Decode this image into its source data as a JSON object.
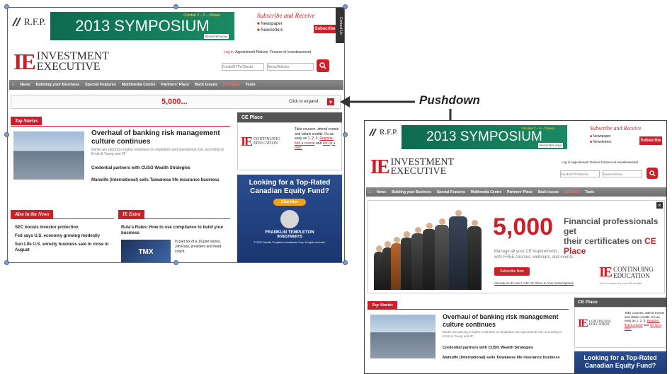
{
  "left": {
    "rfp_logo": "R.F.P.",
    "symposium": {
      "dates": "October 2 – 5 – Ottawa",
      "title": "2013 SYMPOSIUM",
      "register": "REGISTER NOW"
    },
    "subscribe": {
      "title": "Subscribe and Receive",
      "items": [
        "Newspaper",
        "Newsletters"
      ],
      "button": "Subscribe"
    },
    "contact_tab": "Contact Us",
    "ie": {
      "letters": "IE",
      "line1": "INVESTMENT",
      "line2": "EXECUTIVE"
    },
    "toplinks": [
      "Log in",
      "Appointment Notices",
      "Finance et Investissement"
    ],
    "search": {
      "placeholder1": "Funds/ETFs/Stocks",
      "placeholder2": "News/Articles"
    },
    "nav": [
      "⌂",
      "News",
      "Building your Business",
      "Special Features",
      "Multimedia Centre",
      "Partners' Place",
      "Back Issues",
      "CE Place",
      "Tools"
    ],
    "pushdown": {
      "number": "5,000...",
      "expand": "Click to expand",
      "plus": "+"
    },
    "top_stories": "Top Stories",
    "headline": "Overhaul of banking risk management culture continues",
    "headline_sub": "Banks are placing a higher emphasis on regulation and operational risk, according to Ernst & Young and IIF",
    "story2": "Credential partners with CUSO Wealth Strategies",
    "story3": "Manulife (International) sells Taiwanese life insurance business",
    "ce_place": "CE Place",
    "ce_logo": {
      "line1": "CONTINUING",
      "line2": "EDUCATION"
    },
    "ce_text": "Take courses, attend events and obtain credits. It's as easy as 1, 2, 3.",
    "ce_register": "Register,",
    "ce_find": "find a course",
    "ce_and": "and",
    "ce_setup": "set up a plan.",
    "ad": {
      "title": "Looking for a Top-Rated Canadian Equity Fund?",
      "button": "Click Here",
      "brand": "FRANKLIN TEMPLETON",
      "brand2": "INVESTMENTS",
      "fine": "© 2013 Franklin Templeton Investments Corp. All rights reserved."
    },
    "also_news": "Also in the News",
    "news_items": [
      "SEC boosts investor protection",
      "Fed says U.S. economy growing modestly",
      "Sun Life U.S. annuity business sale to close in August"
    ],
    "ie_extra": "IE Extra",
    "extra_headline": "Ruta's Rules: How to use compliance to build your business",
    "tmx": "TMX",
    "extra_text": "In part six of a 10-part series, Jim Ruta, president and head coach,"
  },
  "callout": "Pushdown",
  "right": {
    "rfp_logo": "R.F.P.",
    "symposium": {
      "dates": "October 2 – 5 – Ottawa",
      "title": "2013 SYMPOSIUM",
      "register": "REGISTER NOW"
    },
    "subscribe": {
      "title": "Subscribe and Receive",
      "items": [
        "Newspaper",
        "Newsletters"
      ],
      "button": "Subscribe"
    },
    "ie": {
      "letters": "IE",
      "line1": "INVESTMENT",
      "line2": "EXECUTIVE"
    },
    "toplinks": "Log in  Appointment Notices  Finance et Investissement",
    "search": {
      "placeholder1": "Funds/ETFs/Stocks",
      "placeholder2": "News/Articles"
    },
    "nav": [
      "⌂",
      "News",
      "Building your Business",
      "Special Features",
      "Multimedia Centre",
      "Partners' Place",
      "Back Issues",
      "CE Place",
      "Tools"
    ],
    "expanded": {
      "close": "×",
      "number": "5,000",
      "tagline1": "Financial professionals get",
      "tagline2": "their certificates on",
      "tagline_link": "CE Place",
      "body1": "Manage all your CE requirements,",
      "body2": "with FREE courses, webinars, and events.",
      "button": "Subscribe Now",
      "already": "Already an IE user? Add CE Place to Your Subscriptions",
      "ce_line1": "CONTINUING",
      "ce_line2": "EDUCATION",
      "ce_tagline": "The #1 source for your CE credits."
    },
    "top_stories": "Top Stories",
    "headline": "Overhaul of banking risk management culture continues",
    "headline_sub": "Banks are placing a higher emphasis on regulation and operational risk, according to Ernst & Young and IIF",
    "story2": "Credential partners with CUSO Wealth Strategies",
    "story3": "Manulife (International) sells Taiwanese life insurance business",
    "ce_place": "CE Place",
    "ce_text": "Take courses, attend events and obtain credits. It's as easy as 1, 2, 3.",
    "ce_register": "Register,",
    "ce_find": "find a course",
    "ce_setup": "set up a plan.",
    "ad_title": "Looking for a Top-Rated Canadian Equity Fund?"
  }
}
